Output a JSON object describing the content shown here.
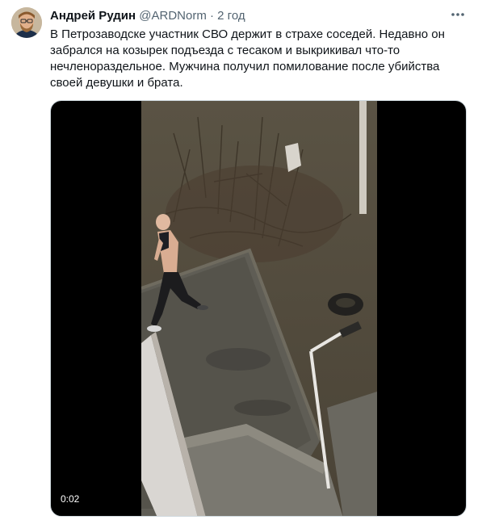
{
  "tweet": {
    "author": {
      "display_name": "Андрей Рудин",
      "handle": "@ARDNorm",
      "separator": "·",
      "time": "2 год"
    },
    "text_lines": [
      "В Петрозаводске участник СВО держит в страхе соседей. Недавно он",
      "забрался на козырек подъезда с тесаком и выкрикивал что-то",
      "нечленораздельное. Мужчина получил помилование после убийства",
      "своей девушки и брата."
    ],
    "media": {
      "duration": "0:02"
    },
    "more_icon": "more-horizontal-icon"
  }
}
